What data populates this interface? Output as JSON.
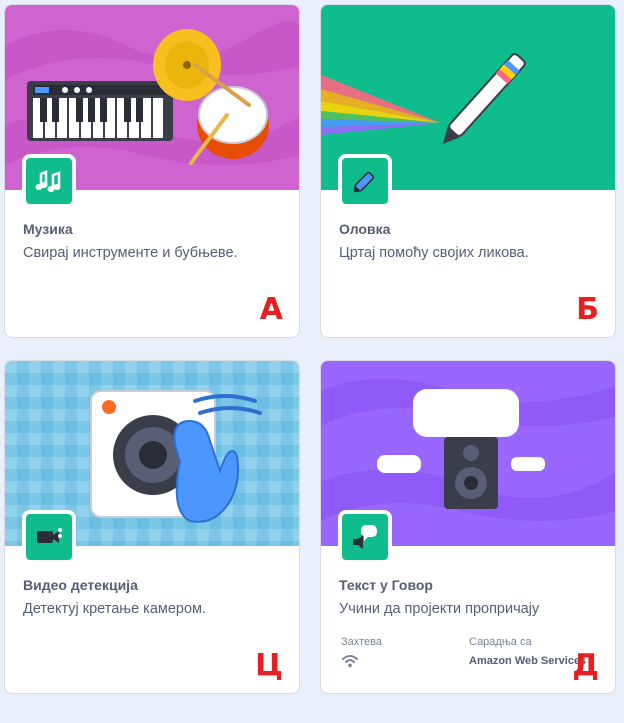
{
  "cards": [
    {
      "title": "Музика",
      "description": "Свирај инструменте и бубњеве.",
      "letter": "А",
      "banner_color": "#cf63cf",
      "icon": "music-notes-icon"
    },
    {
      "title": "Оловка",
      "description": "Цртај помоћу својих ликова.",
      "letter": "Б",
      "banner_color": "#0fbd8c",
      "icon": "pen-icon"
    },
    {
      "title": "Видео детекција",
      "description": "Детектуј кретање камером.",
      "letter": "Ц",
      "banner_color": "#4c97ff",
      "icon": "video-camera-icon"
    },
    {
      "title": "Текст у Говор",
      "description": "Учини да пројекти пропричају",
      "letter": "Д",
      "banner_color": "#9966ff",
      "icon": "speech-bubble-speaker-icon",
      "requires_label": "Захтева",
      "requires_icon": "wifi-icon",
      "collaboration_label": "Сарадња са",
      "collaboration_value": "Amazon Web Services"
    }
  ],
  "colors": {
    "badge": "#0fbd8c",
    "text": "#575e75",
    "letter": "#e62020",
    "page_background": "#e9f0fb"
  }
}
